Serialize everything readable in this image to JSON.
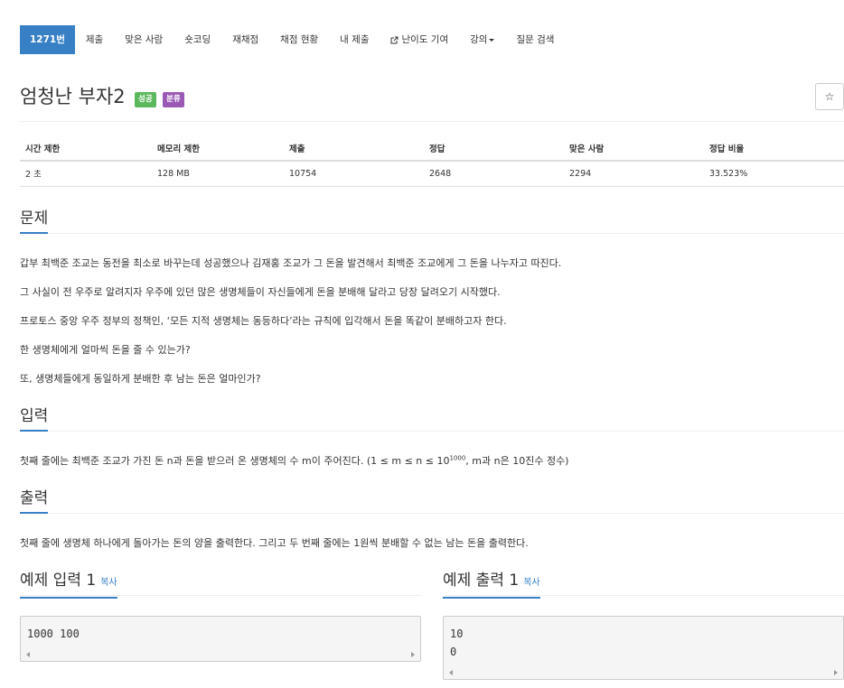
{
  "nav": {
    "items": [
      {
        "label": "1271번",
        "active": true
      },
      {
        "label": "제출"
      },
      {
        "label": "맞은 사람"
      },
      {
        "label": "숏코딩"
      },
      {
        "label": "재채점"
      },
      {
        "label": "채점 현황"
      },
      {
        "label": "내 제출"
      },
      {
        "label": "난이도 기여",
        "icon": "external-link-icon"
      },
      {
        "label": "강의",
        "dropdown": true
      },
      {
        "label": "질문 검색"
      }
    ]
  },
  "problem": {
    "title": "엄청난 부자2",
    "badges": {
      "success": "성공",
      "tag": "분류"
    },
    "star_label": "☆"
  },
  "info_table": {
    "headers": [
      "시간 제한",
      "메모리 제한",
      "제출",
      "정답",
      "맞은 사람",
      "정답 비율"
    ],
    "row": [
      "2 초",
      "128 MB",
      "10754",
      "2648",
      "2294",
      "33.523%"
    ]
  },
  "sections": {
    "description": {
      "heading": "문제",
      "lines": [
        "갑부 최백준 조교는 동전을 최소로 바꾸는데 성공했으나 김재홍 조교가 그 돈을 발견해서 최백준 조교에게 그 돈을 나누자고 따진다.",
        "그 사실이 전 우주로 알려지자 우주에 있던 많은 생명체들이 자신들에게 돈을 분배해 달라고 당장 달려오기 시작했다.",
        "프로토스 중앙 우주 정부의 정책인, ‘모든 지적 생명체는 동등하다’라는 규칙에 입각해서 돈을 똑같이 분배하고자 한다.",
        "한 생명체에게 얼마씩 돈을 줄 수 있는가?",
        "또, 생명체들에게 동일하게 분배한 후 남는 돈은 얼마인가?"
      ]
    },
    "input": {
      "heading": "입력",
      "text_before": "첫째 줄에는 최백준 조교가 가진 돈 n과 돈을 받으러 온 생명체의 수 m이 주어진다. (1 ≤ m ≤ n ≤ 10",
      "exponent": "1000",
      "text_after": ", m과 n은 10진수 정수)"
    },
    "output": {
      "heading": "출력",
      "text": "첫째 줄에 생명체 하나에게 돌아가는 돈의 양을 출력한다. 그리고 두 번째 줄에는 1원씩 분배할 수 없는 남는 돈을 출력한다."
    }
  },
  "examples": {
    "input": {
      "heading": "예제 입력 1",
      "copy": "복사",
      "content": "1000 100"
    },
    "output": {
      "heading": "예제 출력 1",
      "copy": "복사",
      "content": "10\n0"
    }
  },
  "colors": {
    "primary": "#3780c6",
    "success": "#5cb85c",
    "tag": "#9b59b6"
  }
}
